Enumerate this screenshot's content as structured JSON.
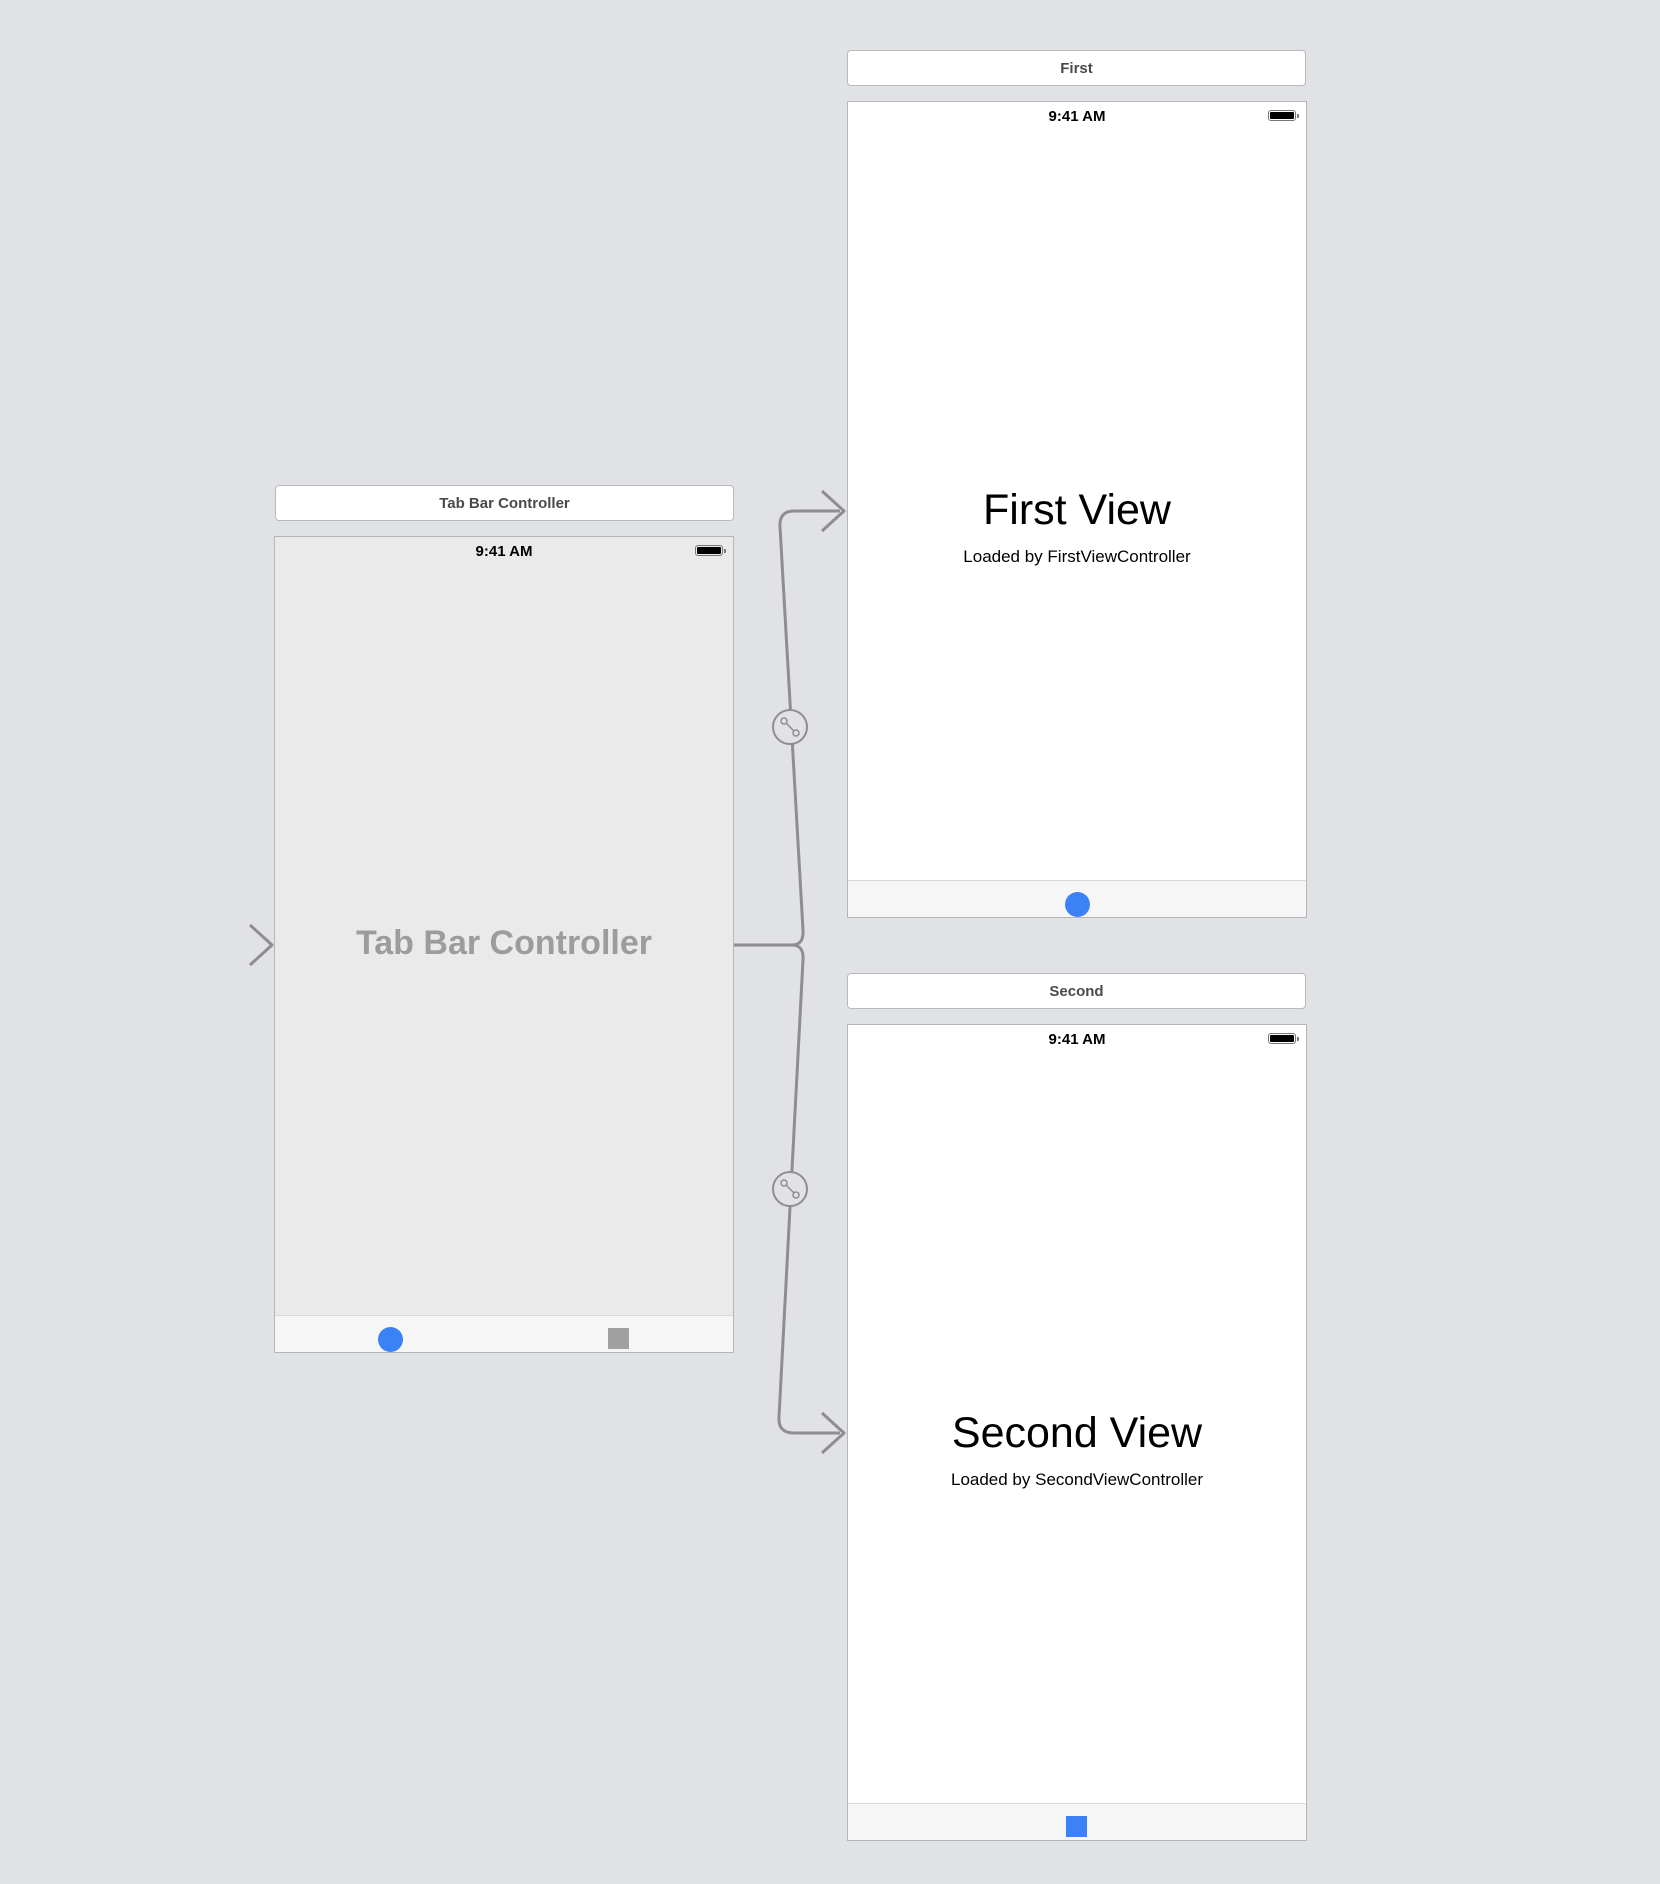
{
  "tab_bar_controller": {
    "header": "Tab Bar Controller",
    "status_time": "9:41 AM",
    "label": "Tab Bar Controller",
    "tab_items": [
      "circle-tab-icon",
      "square-tab-icon"
    ]
  },
  "first_scene": {
    "header": "First",
    "status_time": "9:41 AM",
    "title": "First View",
    "subtitle": "Loaded by FirstViewController",
    "tab_item": "circle-tab-icon"
  },
  "second_scene": {
    "header": "Second",
    "status_time": "9:41 AM",
    "title": "Second View",
    "subtitle": "Loaded by SecondViewController",
    "tab_item": "square-tab-icon"
  },
  "colors": {
    "canvas": "#e1e2e6",
    "tint_blue": "#3a82f6",
    "connection_gray": "#8e8e90"
  }
}
